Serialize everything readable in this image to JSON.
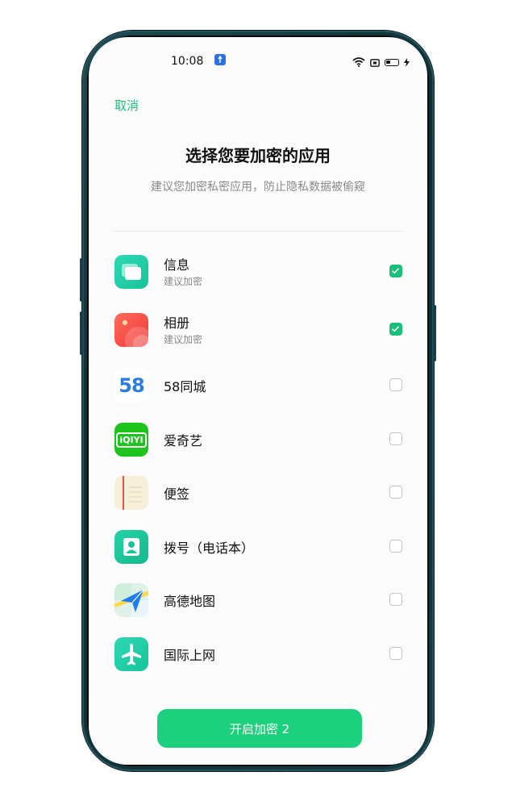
{
  "status_bar": {
    "time": "10:08"
  },
  "header": {
    "cancel_label": "取消",
    "title": "选择您要加密的应用",
    "subtitle": "建议您加密私密应用，防止隐私数据被偷窥"
  },
  "apps": [
    {
      "name": "信息",
      "sub": "建议加密",
      "checked": true,
      "icon": "messages-icon"
    },
    {
      "name": "相册",
      "sub": "建议加密",
      "checked": true,
      "icon": "photos-icon"
    },
    {
      "name": "58同城",
      "sub": "",
      "checked": false,
      "icon": "58-logo-icon"
    },
    {
      "name": "爱奇艺",
      "sub": "",
      "checked": false,
      "icon": "iqiyi-logo-icon"
    },
    {
      "name": "便签",
      "sub": "",
      "checked": false,
      "icon": "notes-icon"
    },
    {
      "name": "拨号（电话本）",
      "sub": "",
      "checked": false,
      "icon": "contacts-icon"
    },
    {
      "name": "高德地图",
      "sub": "",
      "checked": false,
      "icon": "amap-icon"
    },
    {
      "name": "国际上网",
      "sub": "",
      "checked": false,
      "icon": "airplane-icon"
    }
  ],
  "icon_text": {
    "num58": "58",
    "iqiyi": "iQIYI"
  },
  "footer": {
    "open_button_label": "开启加密 2"
  },
  "colors": {
    "accent": "#1dd07e",
    "cancel": "#18c07c"
  }
}
